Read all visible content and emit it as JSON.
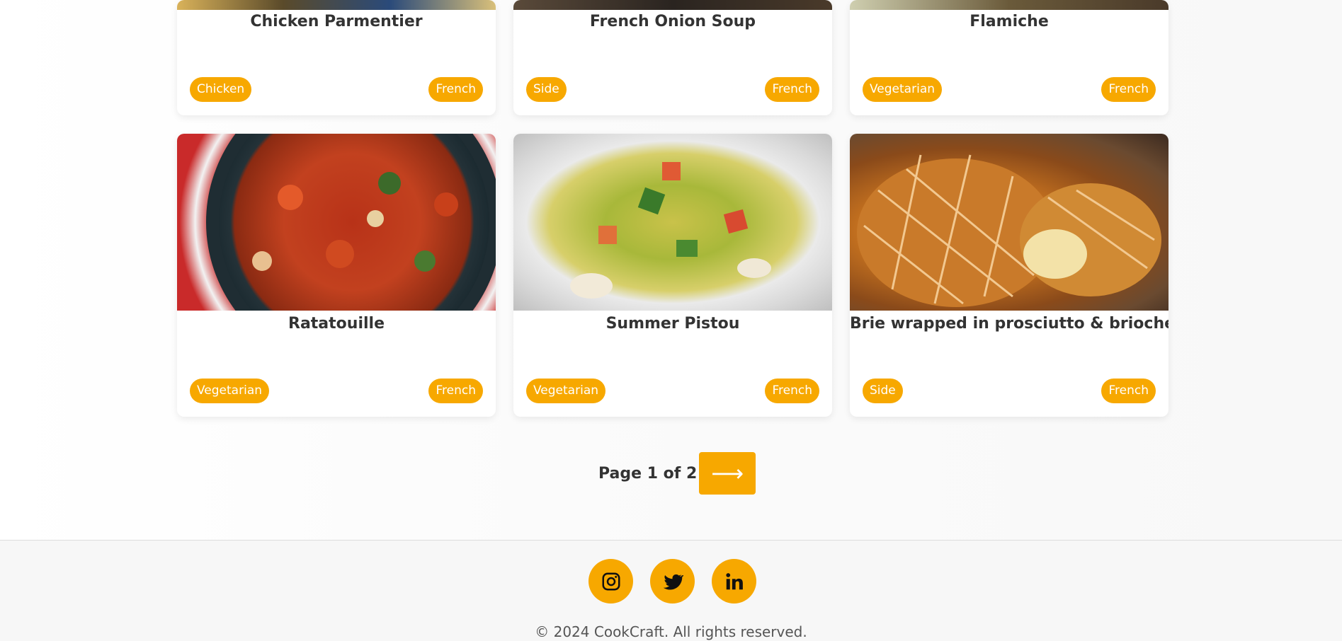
{
  "recipes_row1": [
    {
      "title": "Chicken Parmentier",
      "category": "Chicken",
      "cuisine": "French"
    },
    {
      "title": "French Onion Soup",
      "category": "Side",
      "cuisine": "French"
    },
    {
      "title": "Flamiche",
      "category": "Vegetarian",
      "cuisine": "French"
    }
  ],
  "recipes_row2": [
    {
      "title": "Ratatouille",
      "category": "Vegetarian",
      "cuisine": "French"
    },
    {
      "title": "Summer Pistou",
      "category": "Vegetarian",
      "cuisine": "French"
    },
    {
      "title": "Brie wrapped in prosciutto & brioche",
      "category": "Side",
      "cuisine": "French"
    }
  ],
  "pagination": {
    "label": "Page 1 of 2",
    "next_symbol": "⟶"
  },
  "footer": {
    "social_icons": [
      "instagram-icon",
      "twitter-icon",
      "linkedin-icon"
    ],
    "copyright": "© 2024 CookCraft. All rights reserved."
  },
  "colors": {
    "accent": "#f7a800",
    "text": "#333333"
  }
}
